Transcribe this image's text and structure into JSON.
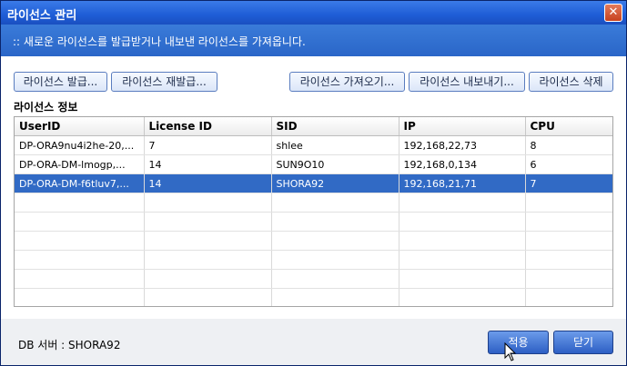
{
  "window": {
    "title": "라이선스 관리",
    "close_label": "✕"
  },
  "banner": {
    "text": ":: 새로운 라이선스를 발급받거나 내보낸 라이선스를 가져옵니다."
  },
  "toolbar": {
    "issue_label": "라이선스 발급...",
    "reissue_label": "라이선스 재발급...",
    "import_label": "라이선스 가져오기...",
    "export_label": "라이선스 내보내기...",
    "delete_label": "라이선스 삭제"
  },
  "section": {
    "title": "라이선스 정보"
  },
  "table": {
    "columns": [
      "UserID",
      "License ID",
      "SID",
      "IP",
      "CPU"
    ],
    "rows": [
      [
        "DP-ORA9nu4i2he-20,...",
        "7",
        "shlee",
        "192,168,22,73",
        "8"
      ],
      [
        "DP-ORA-DM-lmogp,...",
        "14",
        "SUN9O10",
        "192,168,0,134",
        "6"
      ],
      [
        "DP-ORA-DM-f6tluv7,...",
        "14",
        "SHORA92",
        "192,168,21,71",
        "7"
      ]
    ],
    "selected_row": 3
  },
  "footer": {
    "db_label": "DB 서버 : SHORA92",
    "apply_label": "적용",
    "close_label": "닫기"
  },
  "colors": {
    "title_bar": "#1e5dd6",
    "banner": "#2a66c8",
    "selection": "#316ac5"
  }
}
